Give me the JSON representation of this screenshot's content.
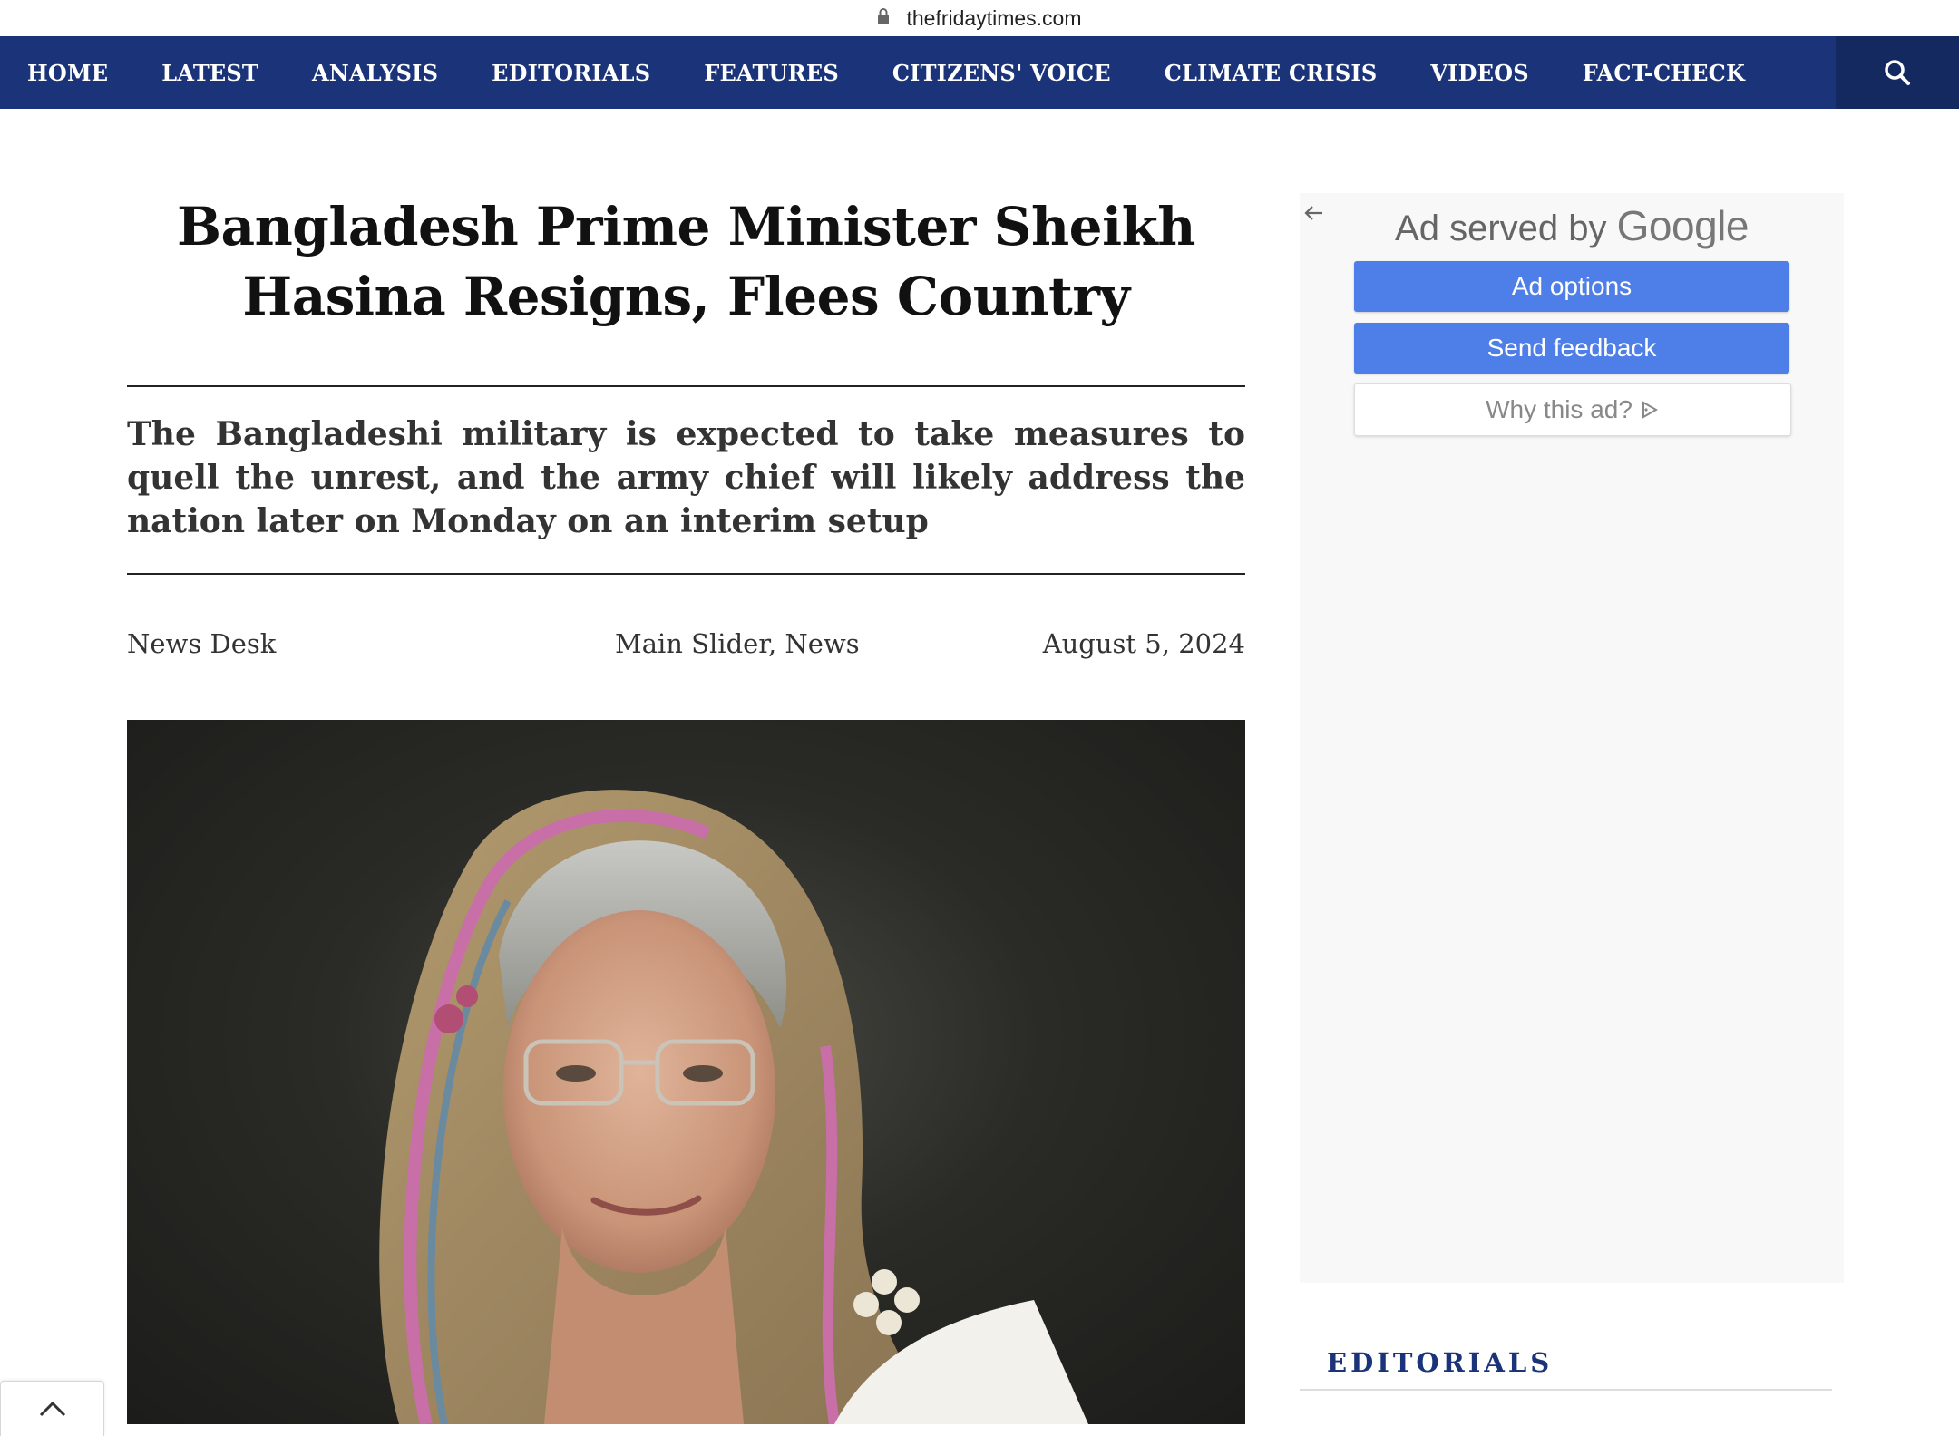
{
  "browser": {
    "url": "thefridaytimes.com"
  },
  "nav": {
    "items": [
      "HOME",
      "LATEST",
      "ANALYSIS",
      "EDITORIALS",
      "FEATURES",
      "CITIZENS' VOICE",
      "CLIMATE CRISIS",
      "VIDEOS",
      "FACT-CHECK"
    ],
    "search_icon": "search-icon"
  },
  "article": {
    "headline_line1": "Bangladesh Prime Minister Sheikh",
    "headline_line2": "Hasina Resigns, Flees Country",
    "dek": "The Bangladeshi military is expected to take measures to quell the unrest, and the army chief will likely address the nation later on Monday on an interim setup",
    "author": "News Desk",
    "categories": "Main Slider, News",
    "date": "August 5, 2024"
  },
  "ad": {
    "title_prefix": "Ad served by",
    "title_brand": "Google",
    "options_label": "Ad options",
    "feedback_label": "Send feedback",
    "why_label": "Why this ad?"
  },
  "sidebar": {
    "section_title": "EDITORIALS"
  },
  "colors": {
    "nav_bg": "#1a3379",
    "ad_button": "#4e7ee8",
    "section_title": "#1a3379"
  }
}
